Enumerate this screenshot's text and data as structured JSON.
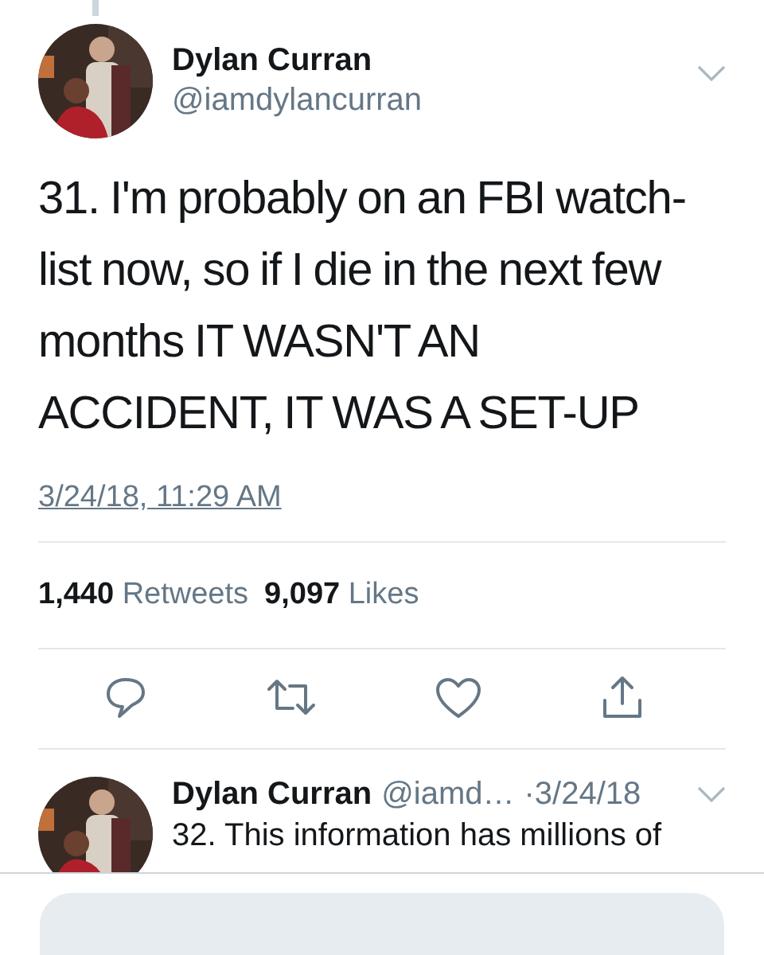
{
  "main_tweet": {
    "author": {
      "name": "Dylan Curran",
      "handle": "@iamdylancurran"
    },
    "text": "31. I'm probably on an FBI watch-list now, so if I die in the next few months IT WASN'T AN ACCIDENT, IT WAS A SET-UP",
    "timestamp": "3/24/18, 11:29 AM",
    "stats": [
      {
        "count": "1,440",
        "label": "Retweets"
      },
      {
        "count": "9,097",
        "label": "Likes"
      }
    ],
    "actions": [
      {
        "kind": "reply"
      },
      {
        "kind": "retweet"
      },
      {
        "kind": "like"
      },
      {
        "kind": "share"
      }
    ]
  },
  "reply_tweet": {
    "name": "Dylan Curran",
    "handle": "@iamd…",
    "time": "·3/24/18",
    "text": "32. This information has millions of"
  }
}
